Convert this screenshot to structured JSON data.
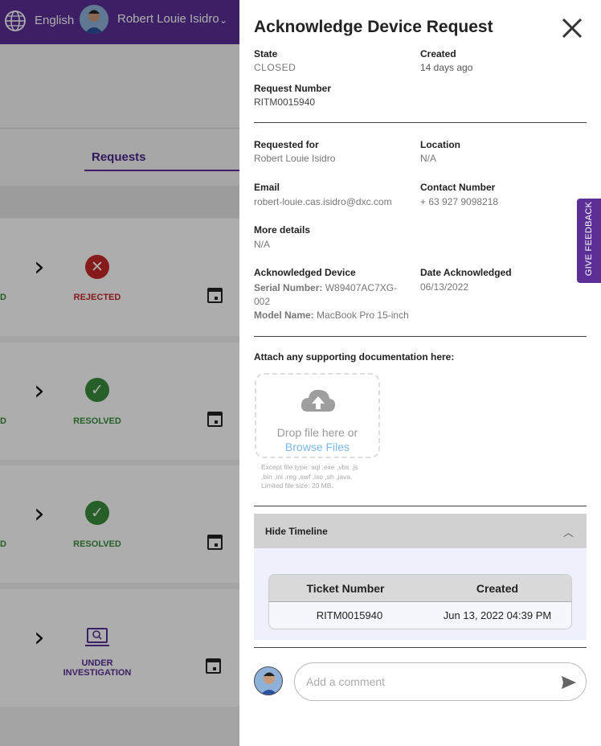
{
  "topbar": {
    "language": "English",
    "user_name": "Robert Louie Isidro"
  },
  "background": {
    "tab_requests": "Requests",
    "cards": [
      {
        "left_label": "D",
        "status": "REJECTED",
        "status_color": "#c62828",
        "icon": "x-circle-icon"
      },
      {
        "left_label": "D",
        "status": "RESOLVED",
        "status_color": "#388e3c",
        "icon": "check-circle-icon"
      },
      {
        "left_label": "D",
        "status": "RESOLVED",
        "status_color": "#388e3c",
        "icon": "check-circle-icon"
      },
      {
        "left_label": "D",
        "status_line1": "UNDER",
        "status_line2": "INVESTIGATION",
        "status_color": "#5b2f96",
        "icon": "laptop-search-icon"
      }
    ]
  },
  "panel": {
    "title": "Acknowledge Device Request",
    "state_label": "State",
    "state_value": "CLOSED",
    "created_label": "Created",
    "created_value": "14 days ago",
    "request_number_label": "Request Number",
    "request_number_value": "RITM0015940",
    "requested_for_label": "Requested for",
    "requested_for_value": "Robert Louie Isidro",
    "location_label": "Location",
    "location_value": "N/A",
    "email_label": "Email",
    "email_value": "robert-louie.cas.isidro@dxc.com",
    "contact_label": "Contact Number",
    "contact_value": "+ 63 927 9098218",
    "more_details_label": "More details",
    "more_details_value": "N/A",
    "ack_device_label": "Acknowledged Device",
    "serial_label": "Serial Number:",
    "serial_value_1": "W89407AC7XG-",
    "serial_value_2": "002",
    "model_label": "Model Name:",
    "model_value": "MacBook Pro 15-inch",
    "date_ack_label": "Date Acknowledged",
    "date_ack_value": "06/13/2022",
    "attach_label": "Attach any supporting documentation here:",
    "drop_text": "Drop file here or",
    "browse_text": "Browse Files",
    "hint_line1": "Except file type: sql ,exe ,vbs ,js",
    "hint_line2": ",bin ,ini ,reg ,swf ,iso ,sh ,java.",
    "hint_line3": "Limited file size: 20 MB.",
    "timeline_toggle": "Hide Timeline",
    "timeline_table": {
      "headers": [
        "Ticket Number",
        "Created"
      ],
      "rows": [
        [
          "RITM0015940",
          "Jun 13, 2022 04:39 PM"
        ]
      ]
    },
    "comment_placeholder": "Add a comment"
  },
  "feedback_tab": "GIVE FEEDBACK",
  "colors": {
    "brand_purple": "#5b2f96",
    "link_blue": "#7ab7e4"
  }
}
